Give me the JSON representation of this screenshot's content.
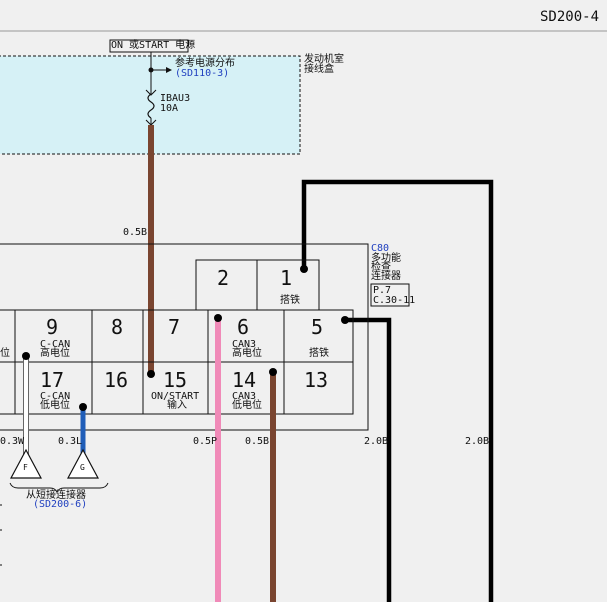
{
  "header": {
    "page_ref": "SD200-4"
  },
  "power": {
    "label": "ON 或START 电源",
    "ref_label": "参考电源分布",
    "ref_link": "(SD110-3)",
    "fuse_name": "IBAU3",
    "fuse_rating": "10A",
    "box_label_1": "发动机室",
    "box_label_2": "接线盒"
  },
  "connector": {
    "id": "C80",
    "name_1": "多功能",
    "name_2": "检查",
    "name_3": "连接器",
    "page": "P.7",
    "coord": "C.30-11"
  },
  "pins": {
    "p1": "1",
    "p1_label": "搭铁",
    "p2": "2",
    "p9": "9",
    "p9_l1": "C-CAN",
    "p9_l2": "高电位",
    "p8": "8",
    "p7": "7",
    "p6": "6",
    "p6_l1": "CAN3",
    "p6_l2": "高电位",
    "p5": "5",
    "p5_label": "搭铁",
    "p17": "17",
    "p17_l1": "C-CAN",
    "p17_l2": "低电位",
    "p16": "16",
    "p15": "15",
    "p15_l1": "ON/START",
    "p15_l2": "输入",
    "p14": "14",
    "p14_l1": "CAN3",
    "p14_l2": "低电位",
    "p13": "13",
    "left_cut": "位"
  },
  "wires": {
    "w_fuse": "0.5B",
    "w_3w": "0.3W",
    "w_3l": "0.3L",
    "w_5p": "0.5P",
    "w_5b": "0.5B",
    "w_2b_a": "2.0B",
    "w_2b_b": "2.0B"
  },
  "splice": {
    "f": "F",
    "g": "G",
    "label": "从短接连接器",
    "link": "(SD200-6)"
  },
  "colors": {
    "brown": "#7a4530",
    "pink": "#f08ab8",
    "blue_wire": "#1f5db8",
    "white_wire": "#ffffff",
    "black_wire": "#000000",
    "box_fill": "#d6f1f6"
  }
}
